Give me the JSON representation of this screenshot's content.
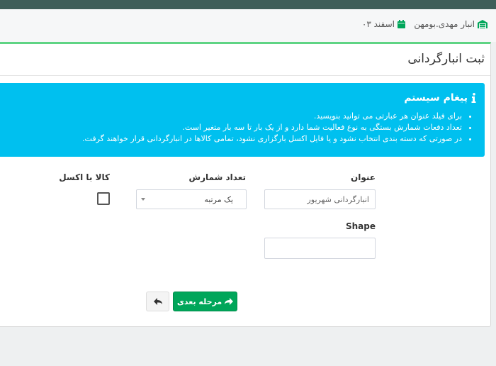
{
  "header": {
    "warehouse": "انبار مهدی.بومهن",
    "date": "اسفند ۰۳"
  },
  "page": {
    "title": "ثبت انبارگردانی"
  },
  "alert": {
    "title": "پیغام سیستم",
    "lines": [
      "برای فیلد عنوان هر عبارتی می توانید بنویسید.",
      "تعداد دفعات شمارش بستگی به نوع فعالیت شما دارد و از یک بار تا سه بار متغیر است.",
      "در صورتی که دسته بندی انتخاب نشود و یا فایل اکسل بارگزاری نشود، تمامی کالاها در انبارگردانی قرار خواهند گرفت."
    ]
  },
  "form": {
    "title_label": "عنوان",
    "title_placeholder": "انبارگردانی شهریور",
    "count_label": "تعداد شمارش",
    "count_value": "یک مرتبه",
    "excel_label": "کالا با اکسل",
    "excel_checked": false,
    "shape_label": "Shape",
    "shape_value": ""
  },
  "actions": {
    "next_label": "مرحله بعدی"
  },
  "colors": {
    "topbar": "#3f5e59",
    "panel_accent": "#5fd484",
    "alert": "#00c0ef",
    "next_button": "#00a65a"
  }
}
